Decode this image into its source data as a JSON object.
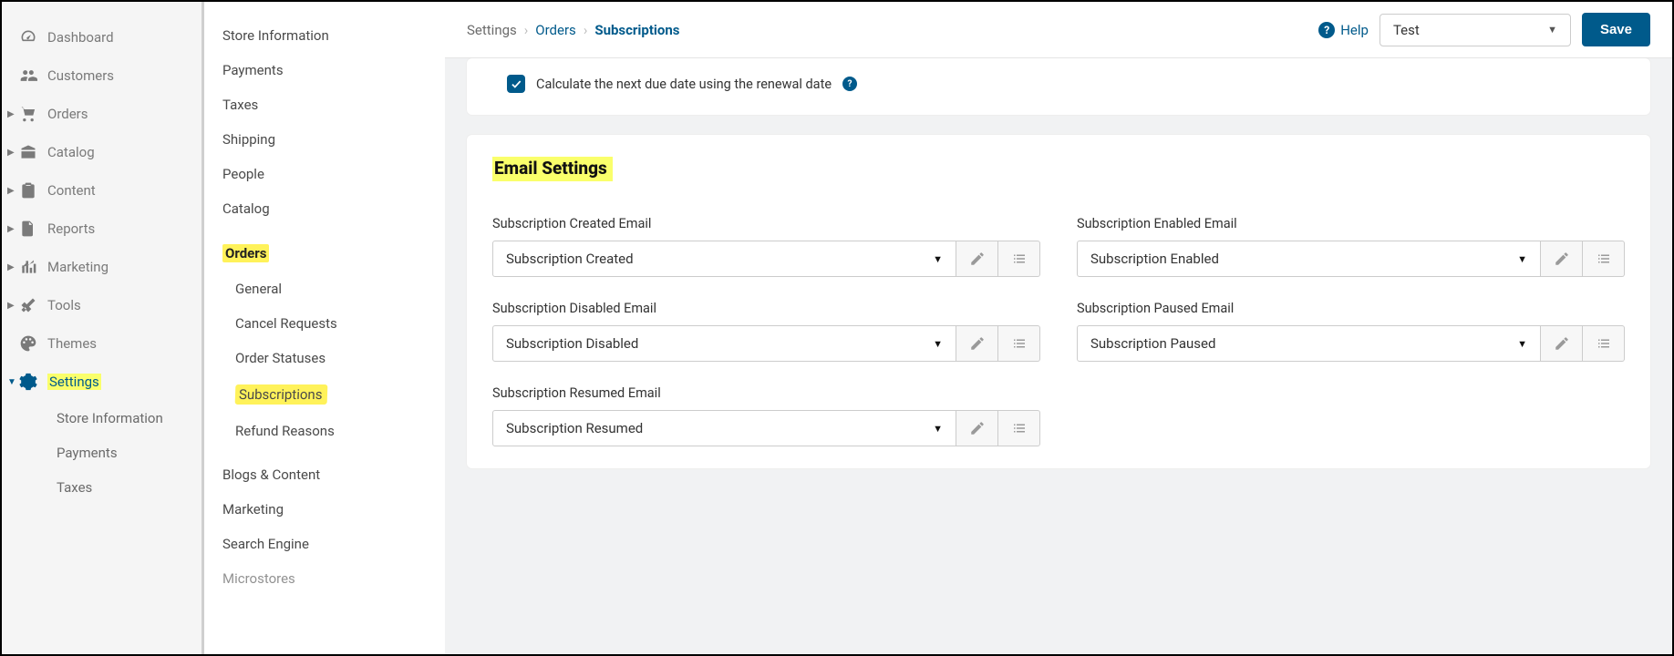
{
  "nav": {
    "dashboard": "Dashboard",
    "customers": "Customers",
    "orders": "Orders",
    "catalog": "Catalog",
    "content": "Content",
    "reports": "Reports",
    "marketing": "Marketing",
    "tools": "Tools",
    "themes": "Themes",
    "settings": "Settings",
    "sub": {
      "store_info": "Store Information",
      "payments": "Payments",
      "taxes": "Taxes"
    }
  },
  "mid": {
    "store_info": "Store Information",
    "payments": "Payments",
    "taxes": "Taxes",
    "shipping": "Shipping",
    "people": "People",
    "catalog": "Catalog",
    "orders": "Orders",
    "orders_sub": {
      "general": "General",
      "cancel_requests": "Cancel Requests",
      "order_statuses": "Order Statuses",
      "subscriptions": "Subscriptions",
      "refund_reasons": "Refund Reasons"
    },
    "blogs": "Blogs & Content",
    "marketing": "Marketing",
    "search": "Search Engine",
    "microstores": "Microstores"
  },
  "breadcrumb": {
    "settings": "Settings",
    "orders": "Orders",
    "subscriptions": "Subscriptions"
  },
  "topbar": {
    "help": "Help",
    "selector_value": "Test",
    "save": "Save"
  },
  "content": {
    "checkbox_label": "Calculate the next due date using the renewal date",
    "section_title": "Email Settings",
    "fields": {
      "created": {
        "label": "Subscription Created Email",
        "value": "Subscription Created"
      },
      "enabled": {
        "label": "Subscription Enabled Email",
        "value": "Subscription Enabled"
      },
      "disabled": {
        "label": "Subscription Disabled Email",
        "value": "Subscription Disabled"
      },
      "paused": {
        "label": "Subscription Paused Email",
        "value": "Subscription Paused"
      },
      "resumed": {
        "label": "Subscription Resumed Email",
        "value": "Subscription Resumed"
      }
    }
  }
}
